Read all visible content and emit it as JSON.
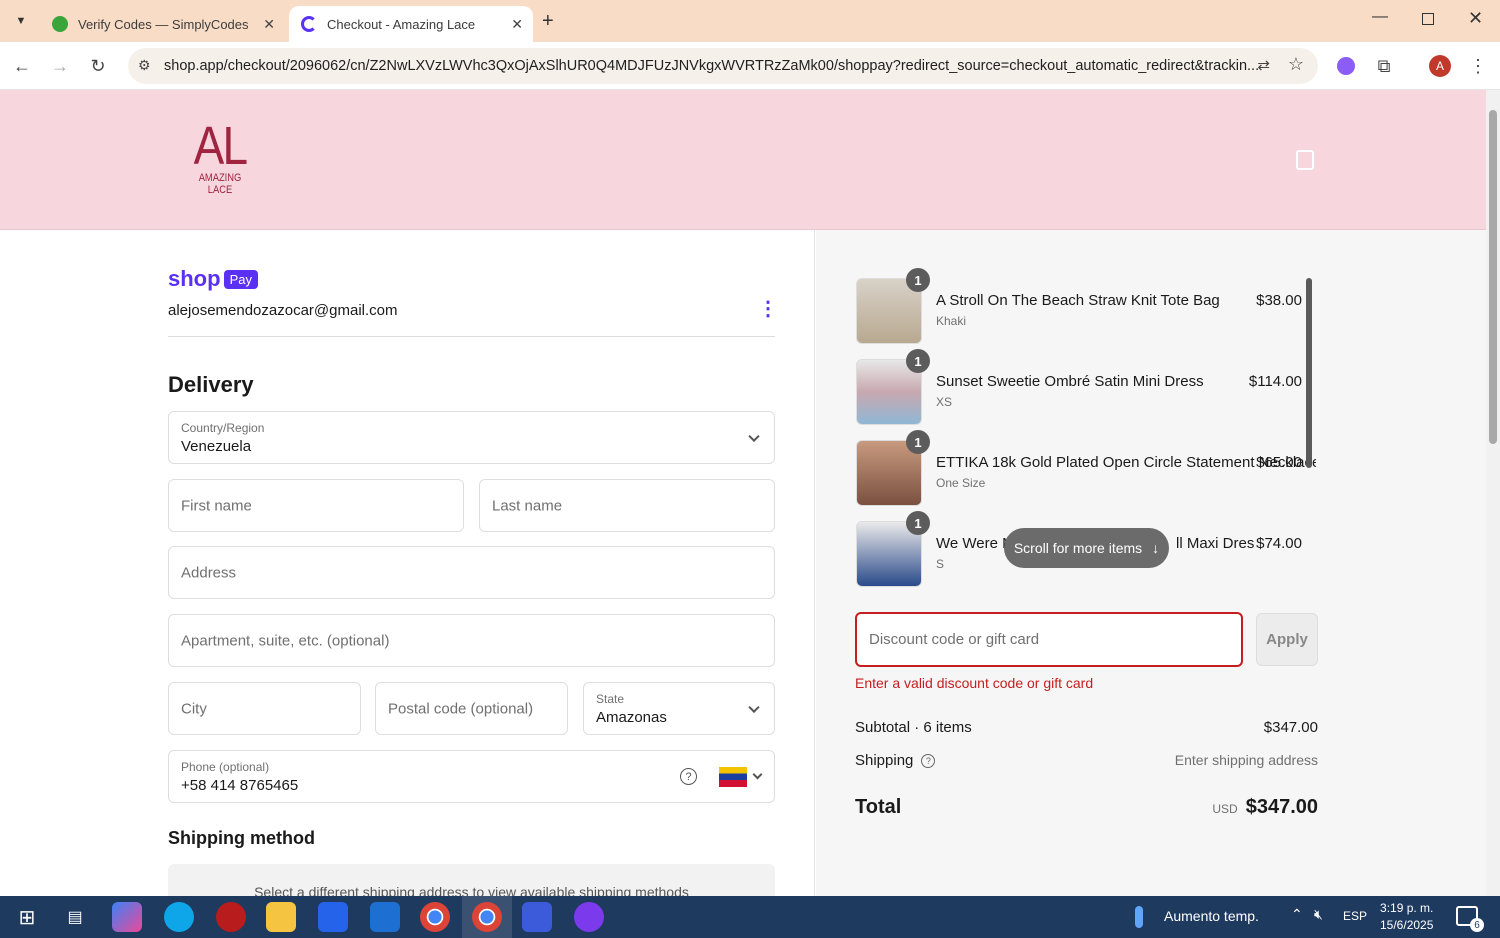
{
  "browser": {
    "tabs": [
      {
        "title": "Verify Codes — SimplyCodes",
        "active": false
      },
      {
        "title": "Checkout - Amazing Lace",
        "active": true
      }
    ],
    "url": "shop.app/checkout/2096062/cn/Z2NwLXVzLWVhc3QxOjAxSlhUR0Q4MDJFUzJNVkgxWVRTRzZaMk00/shoppay?redirect_source=checkout_automatic_redirect&trackin...",
    "profile_initial": "A"
  },
  "store": {
    "logo_big": "AL",
    "logo_small": "AMAZING LACE"
  },
  "shop_pay": {
    "brand": "shop",
    "pay": "Pay",
    "email": "alejosemendozazocar@gmail.com"
  },
  "delivery": {
    "heading": "Delivery",
    "country_label": "Country/Region",
    "country_value": "Venezuela",
    "first_name_placeholder": "First name",
    "last_name_placeholder": "Last name",
    "address_placeholder": "Address",
    "apartment_placeholder": "Apartment, suite, etc. (optional)",
    "city_placeholder": "City",
    "postal_placeholder": "Postal code (optional)",
    "state_label": "State",
    "state_value": "Amazonas",
    "phone_label": "Phone (optional)",
    "phone_value": "+58 414 8765465"
  },
  "shipping_method": {
    "heading": "Shipping method",
    "notice": "Select a different shipping address to view available shipping methods"
  },
  "cart": {
    "items": [
      {
        "qty": "1",
        "name": "A Stroll On The Beach Straw Knit Tote Bag",
        "variant": "Khaki",
        "price": "$38.00"
      },
      {
        "qty": "1",
        "name": "Sunset Sweetie Ombré Satin Mini Dress",
        "variant": "XS",
        "price": "$114.00"
      },
      {
        "qty": "1",
        "name": "ETTIKA 18k Gold Plated Open Circle Statement Necklace",
        "variant": "One Size",
        "price": "$65.00"
      },
      {
        "qty": "1",
        "name": "We Were Me",
        "name_tail": "ll Maxi Dres",
        "variant": "S",
        "price": "$74.00"
      }
    ],
    "scroll_hint": "Scroll for more items",
    "discount_placeholder": "Discount code or gift card",
    "apply_label": "Apply",
    "discount_error": "Enter a valid discount code or gift card",
    "subtotal_label": "Subtotal · 6 items",
    "subtotal_value": "$347.00",
    "shipping_label": "Shipping",
    "shipping_value": "Enter shipping address",
    "total_label": "Total",
    "currency": "USD",
    "total_value": "$347.00"
  },
  "taskbar": {
    "weather": "Aumento temp.",
    "lang": "ESP",
    "time": "3:19 p. m.",
    "date": "15/6/2025",
    "notifications": "6"
  },
  "colors": {
    "header_pink": "#f7d6de",
    "brand_red": "#a0243f",
    "shop_purple": "#5a31f4",
    "error_red": "#c41e1e"
  }
}
